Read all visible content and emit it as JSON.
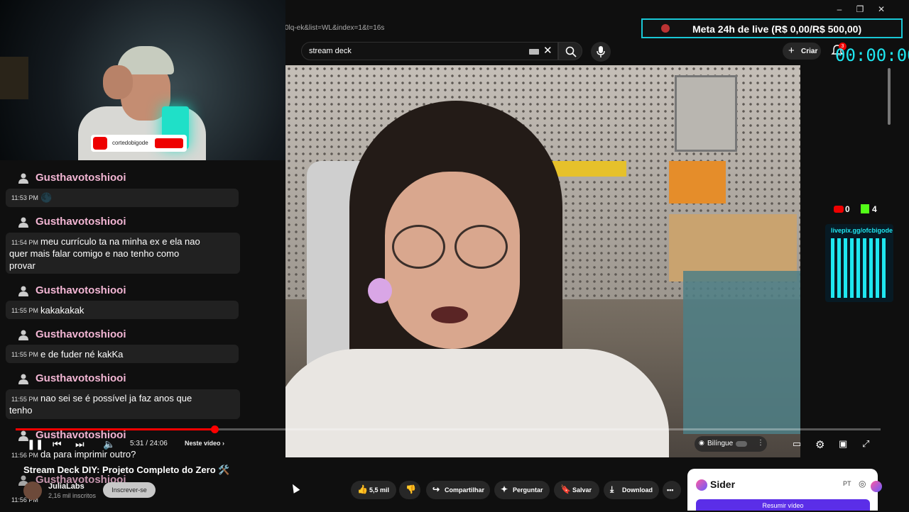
{
  "browser": {
    "url": "0lq-ek&list=WL&index=1&t=16s",
    "window_controls": [
      "–",
      "❐",
      "✕"
    ]
  },
  "header": {
    "search_value": "stream deck",
    "create_label": "Criar",
    "notification_count": "3"
  },
  "overlay": {
    "meta_goal": "Meta 24h de live (R$ 0,00/R$ 500,00)",
    "timer": "00:00:00",
    "cam_tag": "cortedobigode",
    "youtube_viewers": "0",
    "kick_viewers": "4",
    "pix_label": "livepix.gg/ofcbigode"
  },
  "chat": [
    {
      "user": "Gusthavotoshiooi",
      "time": "11:53 PM",
      "message": "🌑"
    },
    {
      "user": "Gusthavotoshiooi",
      "time": "11:54 PM",
      "message": "meu currículo ta na minha ex e ela nao",
      "cont": "quer mais falar comigo e nao tenho como\nprovar"
    },
    {
      "user": "Gusthavotoshiooi",
      "time": "11:55 PM",
      "message": "kakakakak"
    },
    {
      "user": "Gusthavotoshiooi",
      "time": "11:55 PM",
      "message": "e de fuder né kakKa"
    },
    {
      "user": "Gusthavotoshiooi",
      "time": "11:55 PM",
      "message": "nao sei se é possível ja faz anos que",
      "cont": "tenho"
    },
    {
      "user": "Gusthavotoshiooi",
      "time": "11:56 PM",
      "message": "da para imprimir outro?"
    },
    {
      "user": "Gusthavotoshiooi",
      "time": "11:56 PM",
      "message": ""
    }
  ],
  "player": {
    "time": "5:31 / 24:06",
    "next_label": "Neste vídeo ›",
    "progress": 0.23,
    "bilingual_label": "Bilíngue"
  },
  "video": {
    "title": "Stream Deck DIY: Projeto Completo do Zero 🛠️",
    "channel": "JuliaLabs",
    "subscribers": "2,16 mil inscritos",
    "subscribe_label": "Inscrever-se",
    "likes": "5,5 mil",
    "actions": {
      "share": "Compartilhar",
      "ask": "Perguntar",
      "save": "Salvar",
      "download": "Download",
      "more": "•••"
    }
  },
  "sider": {
    "name": "Sider",
    "lang": "PT",
    "button": "Resumir vídeo"
  }
}
